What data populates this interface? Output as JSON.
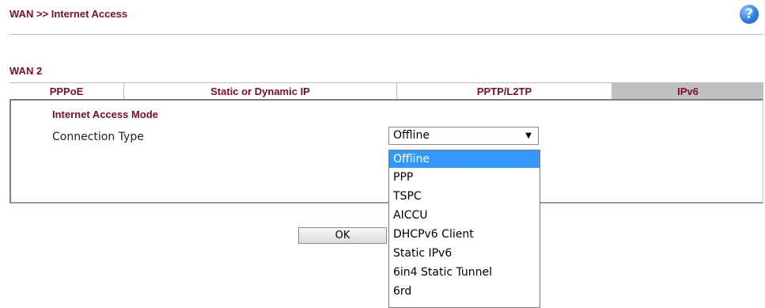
{
  "header": {
    "breadcrumb": "WAN >> Internet Access",
    "help_icon": "?"
  },
  "section_title": "WAN 2",
  "tabs": [
    {
      "label": "PPPoE"
    },
    {
      "label": "Static or Dynamic IP"
    },
    {
      "label": "PPTP/L2TP"
    },
    {
      "label": "IPv6",
      "active": true
    }
  ],
  "form": {
    "group_title": "Internet Access Mode",
    "connection_type_label": "Connection Type",
    "connection_type_value": "Offline",
    "options": [
      "Offline",
      "PPP",
      "TSPC",
      "AICCU",
      "DHCPv6 Client",
      "Static IPv6",
      "6in4 Static Tunnel",
      "6rd"
    ]
  },
  "buttons": {
    "ok_label": "OK"
  },
  "colors": {
    "accent": "#7a0c2e",
    "selected_option": "#3399ff",
    "active_tab": "#c0c0c0"
  }
}
